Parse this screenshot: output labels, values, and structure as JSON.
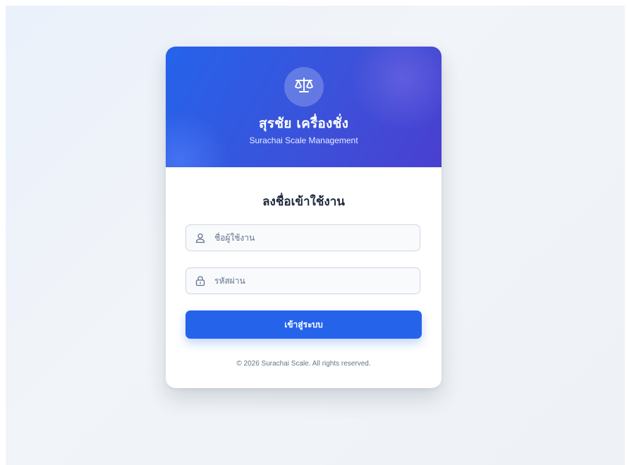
{
  "brand": {
    "title": "สุรชัย เครื่องชั่ง",
    "subtitle": "Surachai Scale Management",
    "logo_icon": "scale-icon"
  },
  "form": {
    "title": "ลงชื่อเข้าใช้งาน",
    "username": {
      "placeholder": "ชื่อผู้ใช้งาน",
      "value": "",
      "icon": "user-icon"
    },
    "password": {
      "placeholder": "รหัสผ่าน",
      "value": "",
      "icon": "lock-icon"
    },
    "submit_label": "เข้าสู่ระบบ"
  },
  "footer": {
    "copyright": "© 2026 Surachai Scale. All rights reserved."
  },
  "colors": {
    "primary": "#2563eb",
    "header_gradient_end": "#4a3fd0",
    "background": "#eef2f7",
    "text_dark": "#1e293b",
    "text_muted": "#64748b"
  }
}
